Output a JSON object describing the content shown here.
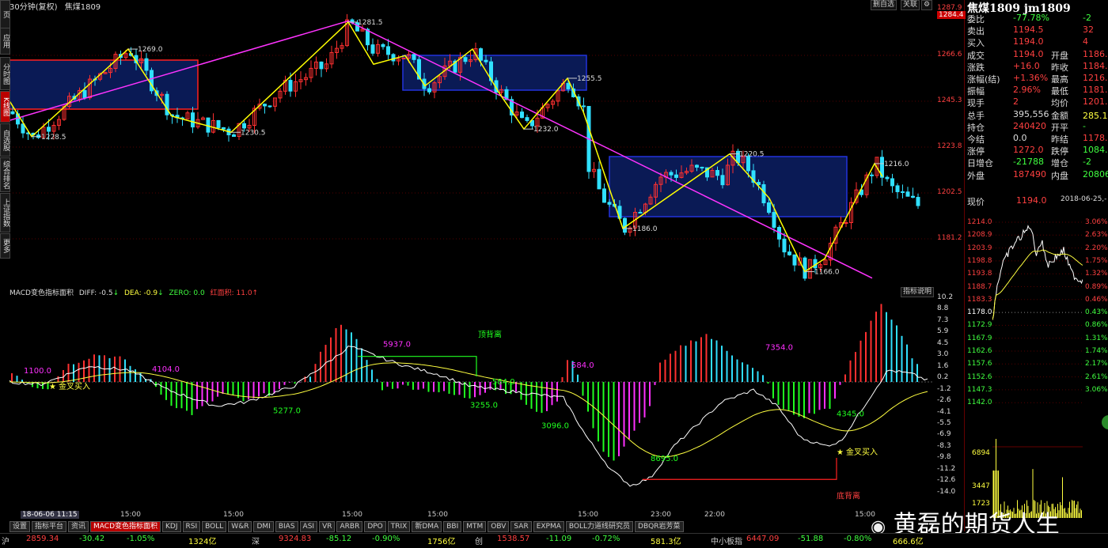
{
  "header": {
    "timeframe": "30分钟(复权)",
    "symbol": "焦煤1809",
    "buttons": [
      "删自选",
      "关联",
      "⚙"
    ],
    "indicator_explain": "指标说明"
  },
  "side_tabs": [
    {
      "label": "页",
      "active": false
    },
    {
      "label": "应用",
      "active": false
    },
    {
      "label": "分时图",
      "active": false
    },
    {
      "label": "K线图",
      "active": true
    },
    {
      "label": "自选股",
      "active": false
    },
    {
      "label": "综合排名",
      "active": false
    },
    {
      "label": "上证指数",
      "active": false
    },
    {
      "label": "更多",
      "active": false
    }
  ],
  "main_axis": [
    "1287.9",
    "1284.4",
    "1266.6",
    "1245.3",
    "1223.8",
    "1202.5",
    "1181.2"
  ],
  "price_labels": [
    {
      "text": "1269.0"
    },
    {
      "text": "1228.5"
    },
    {
      "text": "1230.5"
    },
    {
      "text": "1281.5"
    },
    {
      "text": "1255.5"
    },
    {
      "text": "1232.0"
    },
    {
      "text": "1186.0"
    },
    {
      "text": "1220.5"
    },
    {
      "text": "1216.0"
    },
    {
      "text": "1166.0"
    }
  ],
  "macd": {
    "title": "MACD变色指标面积",
    "diff_label": "DIFF: -0.5",
    "dea_label": "DEA: -0.9",
    "zero_label": "ZERO: 0.0",
    "area_label": "红面积: 11.0",
    "axis": [
      "10.2",
      "8.8",
      "7.3",
      "5.9",
      "4.5",
      "3.0",
      "1.6",
      "0.2",
      "-1.2",
      "-2.6",
      "-4.1",
      "-5.5",
      "-6.9",
      "-8.3",
      "-9.8",
      "-11.2",
      "-12.6",
      "-14.0"
    ],
    "areas": [
      "1100.0",
      "4104.0",
      "5277.0",
      "5937.0",
      "3255.0",
      "3096.0",
      "584.0",
      "8695.0",
      "7354.0",
      "4345.0"
    ],
    "annotations": {
      "gold_cross_1": "金叉买入",
      "gold_cross_2": "金叉买入",
      "top_div": "顶背离",
      "bottom_div": "底背离"
    }
  },
  "time_axis": {
    "first": "18-06-06 11:15",
    "ticks": [
      "15:00",
      "15:00",
      "15:00",
      "15:00",
      "15:00",
      "23:00",
      "22:00",
      "15:00"
    ]
  },
  "indicator_tabs": [
    {
      "label": "设置",
      "active": false
    },
    {
      "label": "指标平台",
      "active": false
    },
    {
      "label": "资讯",
      "active": false
    },
    {
      "label": "MACD变色指标面积",
      "active": true
    },
    {
      "label": "KDJ",
      "active": false
    },
    {
      "label": "RSI",
      "active": false
    },
    {
      "label": "BOLL",
      "active": false
    },
    {
      "label": "W&R",
      "active": false
    },
    {
      "label": "DMI",
      "active": false
    },
    {
      "label": "BIAS",
      "active": false
    },
    {
      "label": "ASI",
      "active": false
    },
    {
      "label": "VR",
      "active": false
    },
    {
      "label": "ARBR",
      "active": false
    },
    {
      "label": "DPO",
      "active": false
    },
    {
      "label": "TRIX",
      "active": false
    },
    {
      "label": "新DMA",
      "active": false
    },
    {
      "label": "BBI",
      "active": false
    },
    {
      "label": "MTM",
      "active": false
    },
    {
      "label": "OBV",
      "active": false
    },
    {
      "label": "SAR",
      "active": false
    },
    {
      "label": "EXPMA",
      "active": false
    },
    {
      "label": "BOLL力道线研究员",
      "active": false
    },
    {
      "label": "DBQR岩芳菜",
      "active": false
    }
  ],
  "quote": {
    "title": "焦煤1809 jm1809",
    "rows": [
      {
        "l1": "委比",
        "v1": "-77.78%",
        "l2": "",
        "v2": "-2"
      },
      {
        "l1": "卖出",
        "v1": "1194.5",
        "l2": "",
        "v2": "32"
      },
      {
        "l1": "买入",
        "v1": "1194.0",
        "l2": "",
        "v2": "4"
      },
      {
        "l1": "成交",
        "v1": "1194.0",
        "l2": "开盘",
        "v2": "1186.0"
      },
      {
        "l1": "涨跌",
        "v1": "+16.0",
        "l2": "昨收",
        "v2": "1184.0"
      },
      {
        "l1": "涨幅(结)",
        "v1": "+1.36%",
        "l2": "最高",
        "v2": "1216.0"
      },
      {
        "l1": "振幅",
        "v1": "2.96%",
        "l2": "最低",
        "v2": "1181.0"
      },
      {
        "l1": "现手",
        "v1": "2",
        "l2": "均价",
        "v2": "1201.0"
      },
      {
        "l1": "总手",
        "v1": "395,556",
        "l2": "金额",
        "v2": "285.1亿"
      },
      {
        "l1": "持仓",
        "v1": "240420",
        "l2": "开平",
        "v2": "-"
      },
      {
        "l1": "今结",
        "v1": "0.0",
        "l2": "昨结",
        "v2": "1178.0"
      },
      {
        "l1": "涨停",
        "v1": "1272.0",
        "l2": "跌停",
        "v2": "1084.0"
      },
      {
        "l1": "日增仓",
        "v1": "-21788",
        "l2": "增仓",
        "v2": "-2"
      },
      {
        "l1": "外盘",
        "v1": "187490",
        "l2": "内盘",
        "v2": "208066"
      }
    ],
    "current_label": "现价",
    "current_value": "1194.0",
    "datetime": "2018-06-25,-"
  },
  "mini_chart": {
    "left_axis": [
      "1214.0",
      "1208.9",
      "1203.9",
      "1198.8",
      "1193.8",
      "1188.7",
      "1183.3",
      "1178.0",
      "1172.9",
      "1167.9",
      "1162.6",
      "1157.6",
      "1152.6",
      "1147.3",
      "1142.0"
    ],
    "right_axis": [
      "3.06%",
      "2.63%",
      "2.20%",
      "1.75%",
      "1.32%",
      "0.89%",
      "0.46%",
      "0.43%",
      "0.86%",
      "1.31%",
      "1.74%",
      "2.17%",
      "2.61%",
      "3.06%"
    ],
    "vol_axis": [
      "6894",
      "3447",
      "1723"
    ]
  },
  "status_bar": [
    {
      "text": "沪",
      "color": "#ccc"
    },
    {
      "text": "2859.34",
      "color": "#ff4040"
    },
    {
      "text": "-30.42",
      "color": "#40ff40"
    },
    {
      "text": "-1.05%",
      "color": "#40ff40"
    },
    {
      "text": "1324亿",
      "color": "#ffff40"
    },
    {
      "text": "深",
      "color": "#ccc"
    },
    {
      "text": "9324.83",
      "color": "#ff4040"
    },
    {
      "text": "-85.12",
      "color": "#40ff40"
    },
    {
      "text": "-0.90%",
      "color": "#40ff40"
    },
    {
      "text": "1756亿",
      "color": "#ffff40"
    },
    {
      "text": "创",
      "color": "#ccc"
    },
    {
      "text": "1538.57",
      "color": "#ff4040"
    },
    {
      "text": "-11.09",
      "color": "#40ff40"
    },
    {
      "text": "-0.72%",
      "color": "#40ff40"
    },
    {
      "text": "581.3亿",
      "color": "#ffff40"
    },
    {
      "text": "中小板指",
      "color": "#ccc"
    },
    {
      "text": "6447.09",
      "color": "#ff4040"
    },
    {
      "text": "-51.88",
      "color": "#40ff40"
    },
    {
      "text": "-0.80%",
      "color": "#40ff40"
    },
    {
      "text": "666.6亿",
      "color": "#ffff40"
    }
  ],
  "watermark": "黄磊的期货人生",
  "colors": {
    "up": "#ff3030",
    "down": "#30e0ff",
    "neg_macd_green": "#20ff20",
    "neg_macd_magenta": "#ff30ff",
    "zigzag": "#ffff00",
    "trend": "#ff33ff"
  }
}
